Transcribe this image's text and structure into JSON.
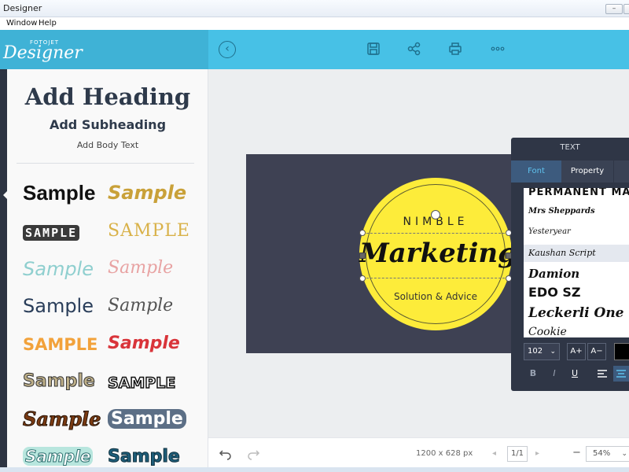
{
  "window": {
    "title": "Designer",
    "minimize": "–",
    "maximize": "☐"
  },
  "menu": {
    "items": [
      "Window",
      "Help"
    ]
  },
  "logo": {
    "small": "FOTOJET",
    "main": "Designer"
  },
  "left_panel": {
    "heading": "Add Heading",
    "subheading": "Add Subheading",
    "body": "Add Body Text",
    "samples": [
      "Sample",
      "Sample",
      "SAMPLE",
      "SAMPLE",
      "Sample",
      "Sample",
      "Sample",
      "Sample",
      "SAMPLE",
      "Sample",
      "Sample",
      "SAMPLE",
      "Sample",
      "Sample",
      "Sample",
      "Sample"
    ]
  },
  "design": {
    "line1": "NIMBLE",
    "line2": "Marketing",
    "line3": "Solution & Advice",
    "background_color": "#3e4153",
    "circle_color": "#fdec3a"
  },
  "text_panel": {
    "title": "TEXT",
    "tabs": [
      "Font",
      "Property",
      ""
    ],
    "fonts": [
      "PERMANENT MARKER",
      "Mrs Sheppards",
      "Yesteryear",
      "Kaushan Script",
      "Damion",
      "EDO SZ",
      "Leckerli One",
      "Cookie"
    ],
    "selected_font": "Kaushan Script",
    "font_size": "102",
    "increase": "A+",
    "decrease": "A−",
    "bold": "B",
    "italic": "I",
    "underline": "U"
  },
  "status": {
    "canvas_size": "1200 x 628 px",
    "page": "1/1",
    "zoom": "54%",
    "zoom_out": "−"
  },
  "colors": {
    "accent": "#47c1e6",
    "panel_dark": "#2f3646"
  }
}
